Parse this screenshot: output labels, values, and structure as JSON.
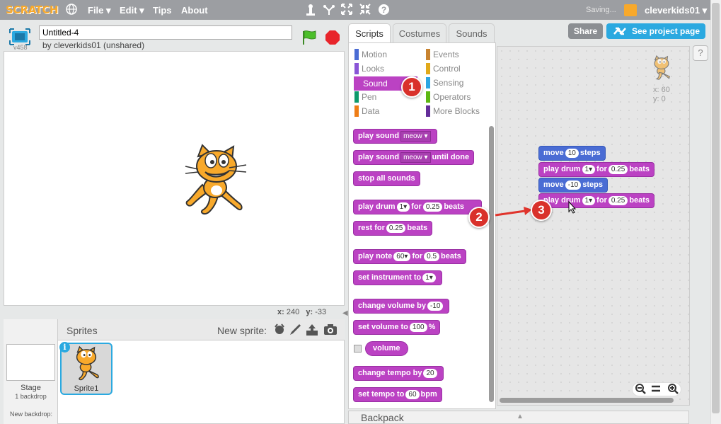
{
  "topbar": {
    "logo": "SCRATCH",
    "menus": [
      "File ▾",
      "Edit ▾",
      "Tips",
      "About"
    ],
    "status": "Saving...",
    "user": "cleverkids01 ▾"
  },
  "stage": {
    "title": "Untitled-4",
    "byline": "by cleverkids01 (unshared)",
    "version": "v458",
    "x_label": "x:",
    "x_value": "240",
    "y_label": "y:",
    "y_value": "-33"
  },
  "sprites": {
    "title": "Sprites",
    "new_sprite": "New sprite:",
    "stage_label": "Stage",
    "backdrop_count": "1 backdrop",
    "new_backdrop": "New backdrop:",
    "sprite_name": "Sprite1",
    "info": "i"
  },
  "tabs": [
    "Scripts",
    "Costumes",
    "Sounds"
  ],
  "header_buttons": {
    "share": "Share",
    "see_project": "See project page",
    "help": "?"
  },
  "categories": [
    {
      "label": "Motion",
      "color": "#4a6cd4"
    },
    {
      "label": "Looks",
      "color": "#8a55d7"
    },
    {
      "label": "Sound",
      "color": "#bb42c3"
    },
    {
      "label": "Pen",
      "color": "#0e9a6c"
    },
    {
      "label": "Data",
      "color": "#ee7d16"
    },
    {
      "label": "Events",
      "color": "#c88330"
    },
    {
      "label": "Control",
      "color": "#e1a91a"
    },
    {
      "label": "Sensing",
      "color": "#2ca5e2"
    },
    {
      "label": "Operators",
      "color": "#5cb712"
    },
    {
      "label": "More Blocks",
      "color": "#632d99"
    }
  ],
  "palette_blocks": {
    "b1": {
      "t1": "play sound",
      "d1": "meow"
    },
    "b2": {
      "t1": "play sound",
      "d1": "meow",
      "t2": "until done"
    },
    "b3": {
      "t1": "stop all sounds"
    },
    "b4": {
      "t1": "play drum",
      "p1": "1▾",
      "t2": "for",
      "p2": "0.25",
      "t3": "beats"
    },
    "b5": {
      "t1": "rest for",
      "p1": "0.25",
      "t2": "beats"
    },
    "b6": {
      "t1": "play note",
      "p1": "60▾",
      "t2": "for",
      "p2": "0.5",
      "t3": "beats"
    },
    "b7": {
      "t1": "set instrument to",
      "p1": "1▾"
    },
    "b8": {
      "t1": "change volume by",
      "p1": "-10"
    },
    "b9": {
      "t1": "set volume to",
      "p1": "100",
      "t2": "%"
    },
    "b10": {
      "t1": "volume"
    },
    "b11": {
      "t1": "change tempo by",
      "p1": "20"
    },
    "b12": {
      "t1": "set tempo to",
      "p1": "60",
      "t2": "bpm"
    }
  },
  "script_blocks": {
    "s1": {
      "t1": "move",
      "p1": "10",
      "t2": "steps"
    },
    "s2": {
      "t1": "play drum",
      "p1": "1▾",
      "t2": "for",
      "p2": "0.25",
      "t3": "beats"
    },
    "s3": {
      "t1": "move",
      "p1": "-10",
      "t2": "steps"
    },
    "s4": {
      "t1": "play drum",
      "p1": "1▾",
      "t2": "for",
      "p2": "0.25",
      "t3": "beats"
    }
  },
  "script_area": {
    "x_label": "x: 60",
    "y_label": "y: 0"
  },
  "backpack": "Backpack",
  "annotations": [
    "1",
    "2",
    "3"
  ]
}
